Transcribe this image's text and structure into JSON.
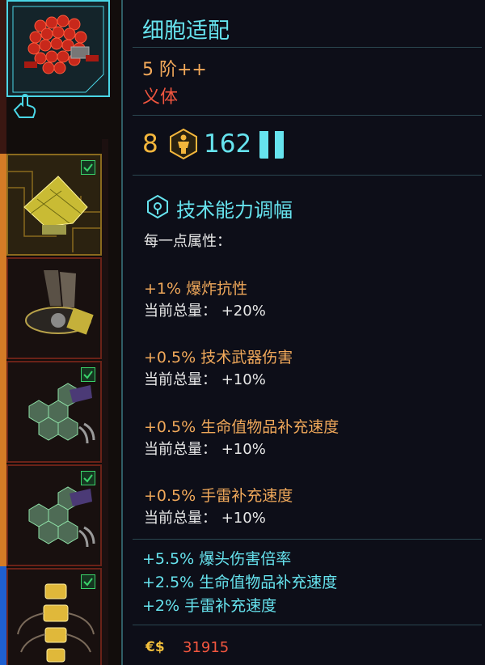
{
  "item": {
    "name": "细胞适配",
    "tier": "5 阶++",
    "type": "义体"
  },
  "requirements": {
    "attribute_level": "8",
    "attribute_icon": "body-attribute-icon",
    "capacity_cost": "162",
    "capacity_icon": "cyberware-capacity-icon"
  },
  "skill": {
    "icon": "tech-ability-icon",
    "name": "技术能力调幅",
    "per_point_label": "每一点属性："
  },
  "bonuses": [
    {
      "effect": "+1% 爆炸抗性",
      "current": "当前总量： +20%"
    },
    {
      "effect": "+0.5% 技术武器伤害",
      "current": "当前总量： +10%"
    },
    {
      "effect": "+0.5% 生命值物品补充速度",
      "current": "当前总量： +10%"
    },
    {
      "effect": "+0.5% 手雷补充速度",
      "current": "当前总量： +10%"
    }
  ],
  "extra_stats": [
    "+5.5% 爆头伤害倍率",
    "+2.5% 生命值物品补充速度",
    "+2% 手雷补充速度"
  ],
  "price": {
    "currency_symbol": "€$",
    "value": "31915"
  },
  "inventory_slots": [
    {
      "icon": "red-hexagon-mesh-cyberware-icon",
      "equipped": false,
      "selected": true
    },
    {
      "icon": "yellow-plate-cyberware-icon",
      "equipped": true
    },
    {
      "icon": "mechanical-arm-cyberware-icon",
      "equipped": false
    },
    {
      "icon": "green-hexagon-plate-cyberware-icon",
      "equipped": true
    },
    {
      "icon": "green-hexagon-plate-cyberware-icon",
      "equipped": true
    },
    {
      "icon": "gold-spine-cyberware-icon",
      "equipped": true
    }
  ],
  "colors": {
    "accent_cyan": "#66e3ee",
    "accent_orange": "#f0a85a",
    "accent_red": "#f2563f",
    "accent_gold": "#f3b63c"
  }
}
